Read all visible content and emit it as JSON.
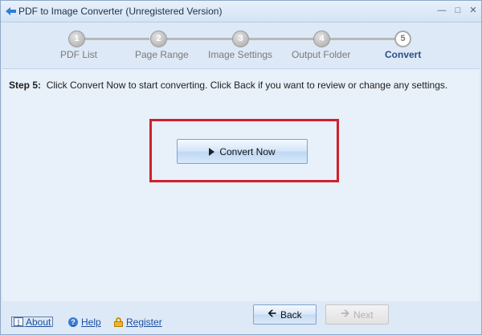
{
  "window": {
    "title": "PDF to Image Converter (Unregistered Version)"
  },
  "steps": [
    {
      "number": "1",
      "label": "PDF List"
    },
    {
      "number": "2",
      "label": "Page Range"
    },
    {
      "number": "3",
      "label": "Image Settings"
    },
    {
      "number": "4",
      "label": "Output Folder"
    },
    {
      "number": "5",
      "label": "Convert"
    }
  ],
  "content": {
    "step_prefix": "Step 5:",
    "instruction": "Click Convert Now to start converting. Click Back if you want to review or change any settings.",
    "convert_label": "Convert Now"
  },
  "footer": {
    "about": "About",
    "help": "Help",
    "register": "Register",
    "back": "Back",
    "next": "Next"
  },
  "colors": {
    "highlight": "#d0202b",
    "active_step": "#2b4e84",
    "link": "#1a4ea0"
  }
}
